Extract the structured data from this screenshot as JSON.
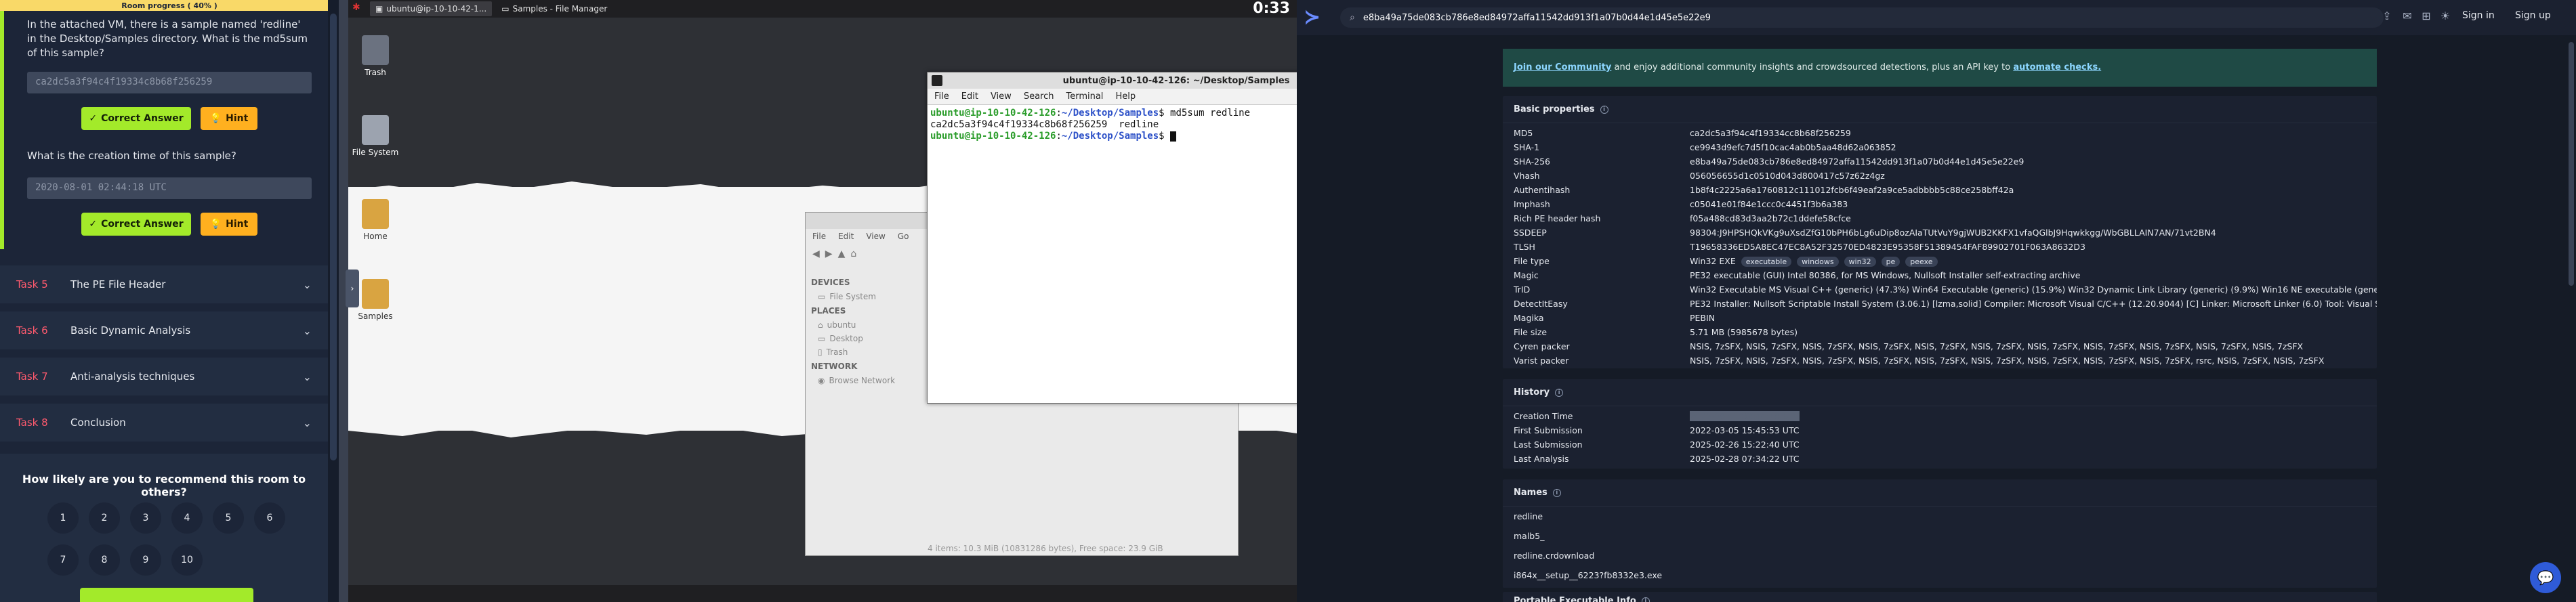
{
  "room": {
    "progress_label": "Room progress ( 40% )",
    "q1_text": "In the attached VM, there is a sample named 'redline' in the Desktop/Samples directory. What is the md5sum of this sample?",
    "q1_answer": "ca2dc5a3f94c4f19334c8b68f256259",
    "q2_text": "What is the creation time of this sample?",
    "q2_answer": "2020-08-01 02:44:18 UTC",
    "correct_label": "Correct Answer",
    "hint_label": "Hint",
    "tasks": [
      {
        "num": "Task 5",
        "title": "The PE File Header"
      },
      {
        "num": "Task 6",
        "title": "Basic Dynamic Analysis"
      },
      {
        "num": "Task 7",
        "title": "Anti-analysis techniques"
      },
      {
        "num": "Task 8",
        "title": "Conclusion"
      }
    ],
    "survey_title": "How likely are you to recommend this room to others?",
    "ratings": [
      "1",
      "2",
      "3",
      "4",
      "5",
      "6",
      "7",
      "8",
      "9",
      "10"
    ],
    "accent_color": "#a3ea2a",
    "hint_color": "#ffb01f"
  },
  "vm": {
    "taskbar": {
      "terminal_task": "ubuntu@ip-10-10-42-1...",
      "fm_task": "Samples - File Manager",
      "clock": "0:33"
    },
    "desktop_icons": [
      "Trash",
      "File System",
      "Home",
      "Samples"
    ],
    "file_manager": {
      "menu": [
        "File",
        "Edit",
        "View",
        "Go"
      ],
      "devices_header": "DEVICES",
      "places_header": "PLACES",
      "network_header": "NETWORK",
      "devices": [
        "File System"
      ],
      "places": [
        "ubuntu",
        "Desktop",
        "Trash"
      ],
      "network": [
        "Browse Network"
      ],
      "status": "4 items: 10.3 MiB (10831286 bytes), Free space: 23.9 GiB"
    },
    "terminal": {
      "title": "ubuntu@ip-10-10-42-126: ~/Desktop/Samples",
      "menu": [
        "File",
        "Edit",
        "View",
        "Search",
        "Terminal",
        "Help"
      ],
      "prompt_user": "ubuntu@ip-10-10-42-126",
      "prompt_dir": "~/Desktop/Samples",
      "command": "md5sum redline",
      "output": "ca2dc5a3f94c4f19334c8b68f256259  redline"
    }
  },
  "vt": {
    "search_value": "e8ba49a75de083cb786e8ed84972affa11542dd913f1a07b0d44e1d45e5e22e9",
    "sign_in": "Sign in",
    "sign_up": "Sign up",
    "banner_link": "Join our Community",
    "banner_text": " and enjoy additional community insights and crowdsourced detections, plus an API key to ",
    "banner_link2": "automate checks.",
    "basic_title": "Basic properties",
    "basic": [
      {
        "k": "MD5",
        "v": "ca2dc5a3f94c4f19334cc8b68f256259"
      },
      {
        "k": "SHA-1",
        "v": "ce9943d9efc7d5f10cac4ab0b5aa48d62a063852"
      },
      {
        "k": "SHA-256",
        "v": "e8ba49a75de083cb786e8ed84972affa11542dd913f1a07b0d44e1d45e5e22e9"
      },
      {
        "k": "Vhash",
        "v": "056056655d1c0510d043d800417c57z62z4gz"
      },
      {
        "k": "Authentihash",
        "v": "1b8f4c2225a6a1760812c111012fcb6f49eaf2a9ce5adbbbb5c88ce258bff42a"
      },
      {
        "k": "Imphash",
        "v": "c05041e01f84e1ccc0c4451f3b6a383"
      },
      {
        "k": "Rich PE header hash",
        "v": "f05a488cd83d3aa2b72c1ddefe58cfce"
      },
      {
        "k": "SSDEEP",
        "v": "98304:J9HPSHQkVKg9uXsdZfG10bPH6bLg6uDip8ozAIaTUtVuY9gjWUB2KKFX1vfaQGlbJ9Hqwkkgg/WbGBLLAIN7AN/71vt2BN4"
      },
      {
        "k": "TLSH",
        "v": "T19658336ED5A8EC47EC8A52F32570ED4823E95358F51389454FAF89902701F063A8632D3"
      }
    ],
    "file_type_label": "File type",
    "file_type": "Win32 EXE",
    "file_type_tags": [
      "executable",
      "windows",
      "win32",
      "pe",
      "peexe"
    ],
    "basic2": [
      {
        "k": "Magic",
        "v": "PE32 executable (GUI) Intel 80386, for MS Windows, Nullsoft Installer self-extracting archive"
      },
      {
        "k": "TrID",
        "v": "Win32 Executable MS Visual C++ (generic) (47.3%)      Win64 Executable (generic) (15.9%)      Win32 Dynamic Link Library (generic) (9.9%)      Win16 NE executable (generic) (7..."
      },
      {
        "k": "DetectItEasy",
        "v": "PE32      Installer: Nullsoft Scriptable Install System (3.06.1) [lzma,solid]      Compiler: Microsoft Visual C/C++ (12.20.9044) [C]      Linker: Microsoft Linker (6.0)      Tool: Visual S..."
      },
      {
        "k": "Magika",
        "v": "PEBIN"
      },
      {
        "k": "File size",
        "v": "5.71 MB (5985678 bytes)"
      },
      {
        "k": "Cyren packer",
        "v": "NSIS, 7zSFX, NSIS, 7zSFX, NSIS, 7zSFX, NSIS, 7zSFX, NSIS, 7zSFX, NSIS, 7zSFX, NSIS, 7zSFX, NSIS, 7zSFX, NSIS, 7zSFX, NSIS, 7zSFX, NSIS, 7zSFX"
      },
      {
        "k": "Varist packer",
        "v": "NSIS, 7zSFX, NSIS, 7zSFX, NSIS, 7zSFX, NSIS, 7zSFX, NSIS, 7zSFX, NSIS, 7zSFX, NSIS, 7zSFX, NSIS, 7zSFX, NSIS, 7zSFX, rsrc, NSIS, 7zSFX, NSIS, 7zSFX"
      }
    ],
    "history_title": "History",
    "history": [
      {
        "k": "Creation Time",
        "v": "2020-08-01 02:44:18 UTC"
      },
      {
        "k": "First Submission",
        "v": "2022-03-05 15:45:53 UTC"
      },
      {
        "k": "Last Submission",
        "v": "2025-02-26 15:22:40 UTC"
      },
      {
        "k": "Last Analysis",
        "v": "2025-02-28 07:34:22 UTC"
      }
    ],
    "names_title": "Names",
    "names": [
      "redline",
      "malb5_",
      "redline.crdownload",
      "i864x__setup__6223?fb8332e3.exe"
    ],
    "pe_title": "Portable Executable Info"
  }
}
